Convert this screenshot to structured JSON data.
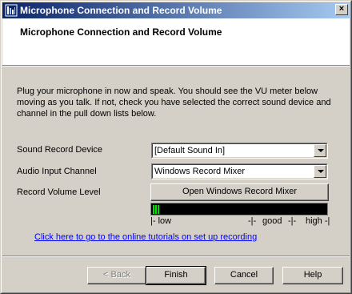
{
  "window": {
    "title": "Microphone Connection and Record Volume",
    "close_glyph": "×"
  },
  "header": {
    "title": "Microphone Connection and Record Volume"
  },
  "intro": "Plug your microphone in now and speak. You should see the VU meter below moving as you talk. If not, check you have selected the correct sound device and channel in the pull down lists below.",
  "form": {
    "sound_device_label": "Sound Record Device",
    "sound_device_value": "[Default Sound In]",
    "input_channel_label": "Audio Input Channel",
    "input_channel_value": "Windows Record Mixer",
    "record_volume_label": "Record Volume Level",
    "open_mixer_button": "Open Windows Record Mixer"
  },
  "vu_meter": {
    "level_bars": 3,
    "scale_low": "|- low",
    "scale_mark1": "-|-",
    "scale_good": "good",
    "scale_mark2": "-|-",
    "scale_high": "high -|"
  },
  "link_text": "Click here to go to the online tutorials on set up recording",
  "buttons": {
    "back": "< Back",
    "finish": "Finish",
    "cancel": "Cancel",
    "help": "Help"
  },
  "colors": {
    "title_start": "#0a246a",
    "title_end": "#a6caf0",
    "vu_green": "#00e000",
    "link": "#0000ff"
  }
}
